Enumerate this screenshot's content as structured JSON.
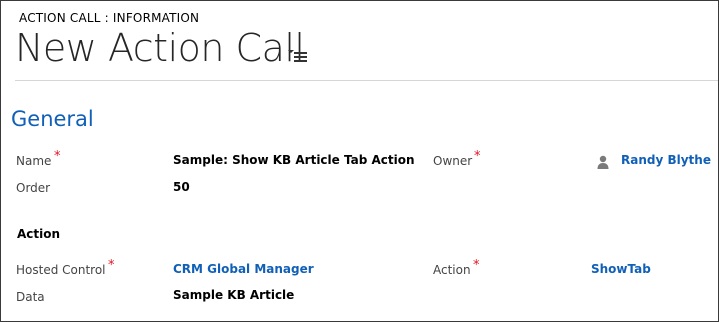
{
  "header": {
    "entity_label": "ACTION CALL : INFORMATION",
    "title": "New Action Call",
    "title_menu_icon": "dropdown-list-icon"
  },
  "sections": {
    "general": {
      "title": "General",
      "fields": {
        "name": {
          "label": "Name",
          "required_mark": "*",
          "value": "Sample: Show KB Article Tab Action"
        },
        "owner": {
          "label": "Owner",
          "required_mark": "*",
          "value": "Randy Blythe",
          "icon": "user-icon"
        },
        "order": {
          "label": "Order",
          "value": "50"
        }
      }
    },
    "action": {
      "title": "Action",
      "fields": {
        "hosted_control": {
          "label": "Hosted Control",
          "required_mark": "*",
          "value": "CRM Global Manager"
        },
        "action": {
          "label": "Action",
          "required_mark": "*",
          "value": "ShowTab"
        },
        "data": {
          "label": "Data",
          "value": "Sample KB Article"
        }
      }
    }
  },
  "colors": {
    "accent_link": "#1160b7",
    "required": "#e81123",
    "border": "#3a3a3a"
  }
}
